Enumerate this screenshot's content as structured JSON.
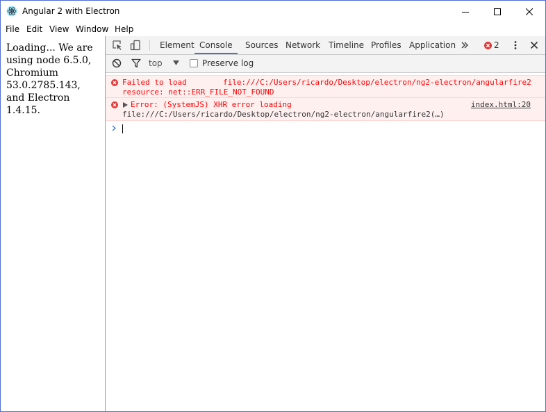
{
  "window": {
    "title": "Angular 2 with Electron",
    "controls": [
      "minimize-icon",
      "maximize-icon",
      "close-icon"
    ]
  },
  "menu": {
    "items": [
      "File",
      "Edit",
      "View",
      "Window",
      "Help"
    ]
  },
  "page": {
    "text": "Loading... We are using node 6.5.0, Chromium 53.0.2785.143, and Electron 1.4.15."
  },
  "devtools": {
    "tabs": [
      "Elements",
      "Console",
      "Sources",
      "Network",
      "Timeline",
      "Profiles",
      "Application"
    ],
    "active_tab": "Console",
    "more_tabs_icon": "double-chevron-right-icon",
    "error_count": "2",
    "toolbar": {
      "context": "top",
      "preserve_log_label": "Preserve log",
      "preserve_log_checked": false
    },
    "messages": [
      {
        "level": "error",
        "line1_prefix": "Failed to load",
        "line1_url": "file:///C:/Users/ricardo/Desktop/electron/ng2-electron/angularfire2",
        "line2": "resource: net::ERR_FILE_NOT_FOUND"
      },
      {
        "level": "error",
        "line1": "Error: (SystemJS) XHR error loading",
        "line2": "file:///C:/Users/ricardo/Desktop/electron/ng2-electron/angularfire2(…)",
        "source": "index.html:20"
      }
    ]
  },
  "colors": {
    "window_border": "#4f6bd4",
    "devtools_bar": "#f3f3f3",
    "error_text": "#ff0000",
    "error_background": "#fff0f0",
    "active_tab_underline": "#3879d9",
    "error_badge": "#e03a3a",
    "prompt_chevron": "#3879d9"
  }
}
